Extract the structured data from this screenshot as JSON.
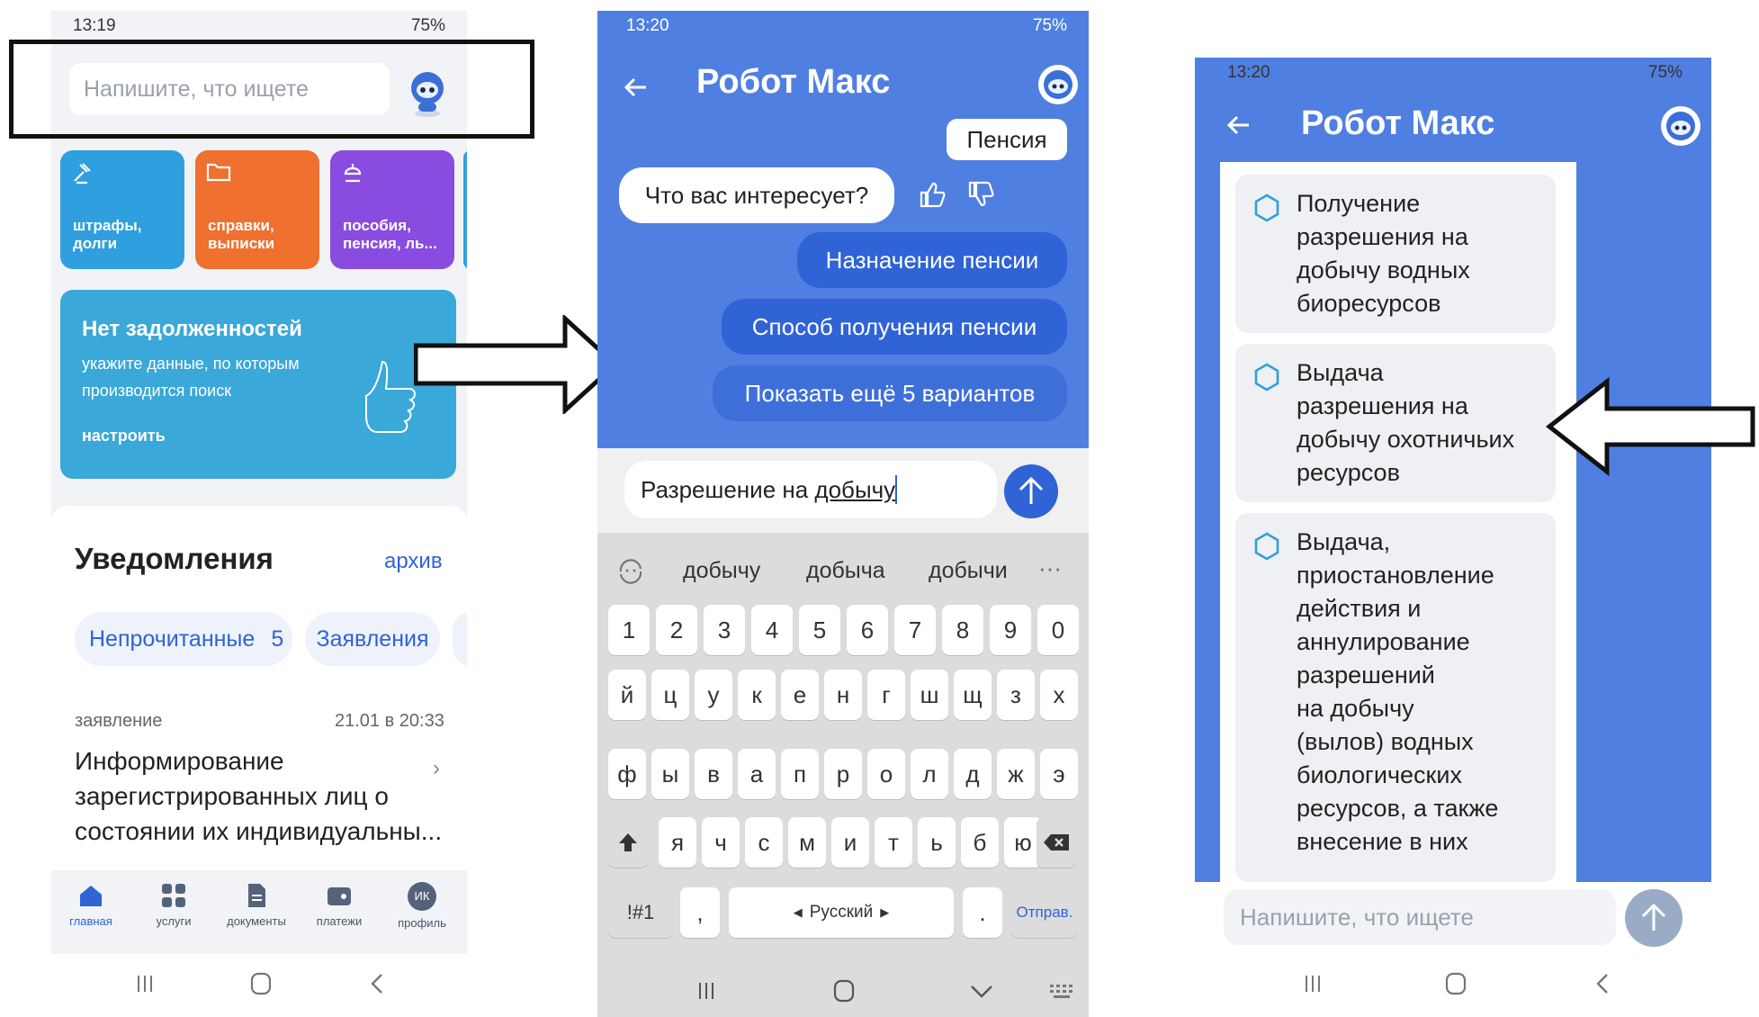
{
  "phone1": {
    "status": {
      "time": "13:19",
      "battery": "75%"
    },
    "search": {
      "placeholder": "Напишите, что ищете"
    },
    "tiles": [
      {
        "line1": "штрафы,",
        "line2": "долги",
        "icon": "gavel-icon",
        "color": "#2f9fe0"
      },
      {
        "line1": "справки,",
        "line2": "выписки",
        "icon": "folder-icon",
        "color": "#f07030"
      },
      {
        "line1": "пособия,",
        "line2": "пенсия, ль...",
        "icon": "stroller-icon",
        "color": "#8a4be0"
      }
    ],
    "banner": {
      "title": "Нет задолженностей",
      "line1": "укажите данные, по которым",
      "line2": "производится поиск",
      "action": "настроить"
    },
    "notifications": {
      "title": "Уведомления",
      "archive": "архив",
      "chips": [
        {
          "label": "Непрочитанные",
          "count": "5"
        },
        {
          "label": "Заявления"
        }
      ],
      "item": {
        "type": "заявление",
        "date": "21.01 в 20:33",
        "text_line1": "Информирование",
        "text_line2": "зарегистрированных лиц о",
        "text_line3": "состоянии их индивидуальны..."
      }
    },
    "nav": [
      {
        "label": "главная",
        "icon": "home-icon"
      },
      {
        "label": "услуги",
        "icon": "grid-icon"
      },
      {
        "label": "документы",
        "icon": "document-icon"
      },
      {
        "label": "платежи",
        "icon": "wallet-icon"
      },
      {
        "label": "профиль",
        "icon": "avatar-icon",
        "initials": "ИК"
      }
    ]
  },
  "phone2": {
    "status": {
      "time": "13:20",
      "battery": "75%"
    },
    "header": {
      "title": "Робот Макс"
    },
    "chat": {
      "user_msg": "Пенсия",
      "bot_msg": "Что вас интересует?",
      "options": [
        "Назначение пенсии",
        "Способ получения пенсии",
        "Показать ещё 5 вариантов"
      ]
    },
    "input": {
      "value_prefix": "Разрешение на ",
      "value_word": "добычу"
    },
    "suggestions": [
      "добычу",
      "добыча",
      "добычи"
    ],
    "keyboard": {
      "row_digits": [
        "1",
        "2",
        "3",
        "4",
        "5",
        "6",
        "7",
        "8",
        "9",
        "0"
      ],
      "row1": [
        "й",
        "ц",
        "у",
        "к",
        "е",
        "н",
        "г",
        "ш",
        "щ",
        "з",
        "х"
      ],
      "row2": [
        "ф",
        "ы",
        "в",
        "а",
        "п",
        "р",
        "о",
        "л",
        "д",
        "ж",
        "э"
      ],
      "row3": [
        "я",
        "ч",
        "с",
        "м",
        "и",
        "т",
        "ь",
        "б",
        "ю"
      ],
      "symbols": "!#1",
      "comma": ",",
      "language": "Русский",
      "period": ".",
      "send": "Отправ."
    }
  },
  "phone3": {
    "status": {
      "time": "13:20",
      "battery": "75%"
    },
    "header": {
      "title": "Робот Макс"
    },
    "options": [
      {
        "lines": [
          "Получение",
          "разрешения на",
          "добычу водных",
          "биоресурсов"
        ]
      },
      {
        "lines": [
          "Выдача",
          "разрешения на",
          "добычу охотничьих",
          "ресурсов"
        ]
      },
      {
        "lines": [
          "Выдача,",
          "приостановление",
          "действия и",
          "аннулирование",
          "разрешений",
          "на добычу",
          "(вылов) водных",
          "биологических",
          "ресурсов, а также",
          "внесение в них"
        ]
      }
    ],
    "input": {
      "placeholder": "Напишите, что ищете"
    }
  },
  "colors": {
    "chat_blue": "#4f7fe0",
    "pill_blue": "#2f63d6",
    "banner": "#3aa8d8"
  }
}
